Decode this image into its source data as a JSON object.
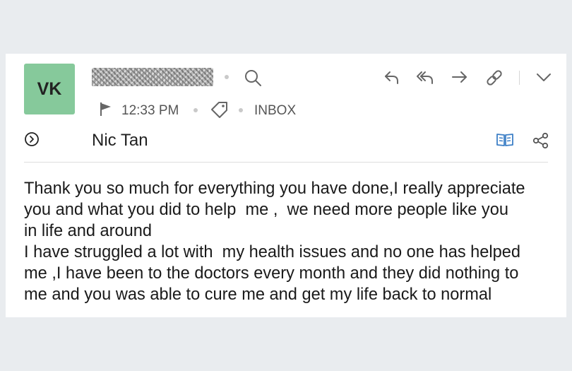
{
  "message": {
    "avatar_initials": "VK",
    "time": "12:33 PM",
    "folder": "INBOX",
    "subject": "Nic Tan",
    "body_lines": [
      "Thank you so much for everything you have done,I really appreciate",
      "you and what you did to help  me ,  we need more people like you",
      "in life and around",
      "I have struggled a lot with  my health issues and no one has helped",
      "me ,I have been to the doctors every month and they did nothing to",
      "me and you was able to cure me and get my life back to normal"
    ]
  },
  "icons": {
    "search": "search-icon",
    "flag": "flag-icon",
    "tag": "tag-icon",
    "expand": "chevron-right-circle-icon",
    "reply": "reply-icon",
    "reply_all": "reply-all-icon",
    "forward": "forward-icon",
    "link": "link-icon",
    "more": "chevron-down-icon",
    "reader": "book-icon",
    "share": "share-icon"
  },
  "colors": {
    "avatar_bg": "#86c99b",
    "page_bg": "#e9ecef",
    "accent_blue": "#3d7fc6"
  }
}
